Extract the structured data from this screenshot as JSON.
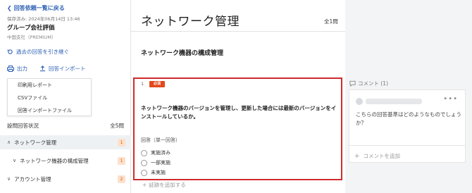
{
  "sidebar": {
    "back_link": "回答依頼一覧に戻る",
    "saved_at": "保存済み: 2024年06月14日 13:46",
    "title": "グループ会社評価",
    "subtitle": "中国支社（PREMIUM）",
    "reuse_link": "過去の回答を引き継ぐ",
    "output_label": "出力",
    "import_label": "回答インポート",
    "dropdown": [
      {
        "label": "印刷用レポート"
      },
      {
        "label": "CSVファイル"
      },
      {
        "label": "回答インポートファイル"
      }
    ],
    "status_label": "設問回答状況",
    "status_count": "全5問",
    "tree": [
      {
        "label": "ネットワーク管理",
        "badge": "1"
      },
      {
        "label": "ネットワーク機器の構成管理",
        "badge": "1"
      },
      {
        "label": "アカウント管理",
        "badge": "2"
      }
    ]
  },
  "main": {
    "page_title": "ネットワーク管理",
    "question_count": "全1問",
    "section_title": "ネットワーク機器の構成管理",
    "question": {
      "number": "1",
      "required": "必須",
      "text": "ネットワーク機器のバージョンを管理し、更新した場合には最新のバージョンをインストールしているか。",
      "answer_label": "回答（単一回答）",
      "options": [
        "実施済み",
        "一部実施",
        "未実施"
      ]
    },
    "add_evidence": "証跡を追加する"
  },
  "comments": {
    "header": "コメント (1)",
    "items": [
      {
        "text": "こちらの回答基準はどのようなものでしょうか？"
      }
    ],
    "add_label": "コメントを追加"
  },
  "colors": {
    "link": "#2b5fb4",
    "highlight_border": "#d12b2b",
    "required_badge": "#e14a1d",
    "badge_bg": "#fde0cc"
  }
}
